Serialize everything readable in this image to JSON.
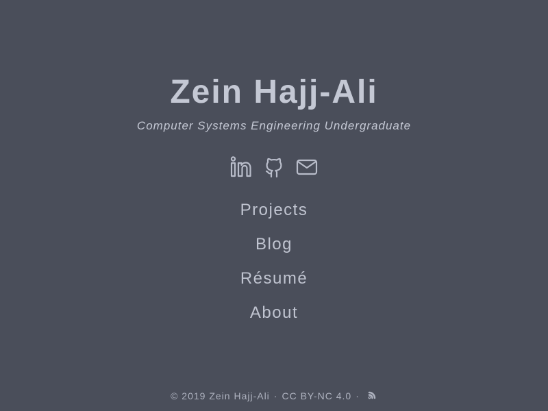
{
  "header": {
    "title": "Zein Hajj-Ali",
    "subtitle": "Computer Systems Engineering Undergraduate"
  },
  "social": [
    {
      "icon": "linkedin-icon"
    },
    {
      "icon": "github-icon"
    },
    {
      "icon": "mail-icon"
    }
  ],
  "nav": {
    "items": [
      {
        "label": "Projects"
      },
      {
        "label": "Blog"
      },
      {
        "label": "Résumé"
      },
      {
        "label": "About"
      }
    ]
  },
  "footer": {
    "copyright": "© 2019 Zein Hajj-Ali",
    "separator": "·",
    "license": "CC BY-NC 4.0",
    "rss_icon": "rss-icon"
  },
  "colors": {
    "background": "#4a4e5a",
    "text": "#c4c8d4"
  }
}
